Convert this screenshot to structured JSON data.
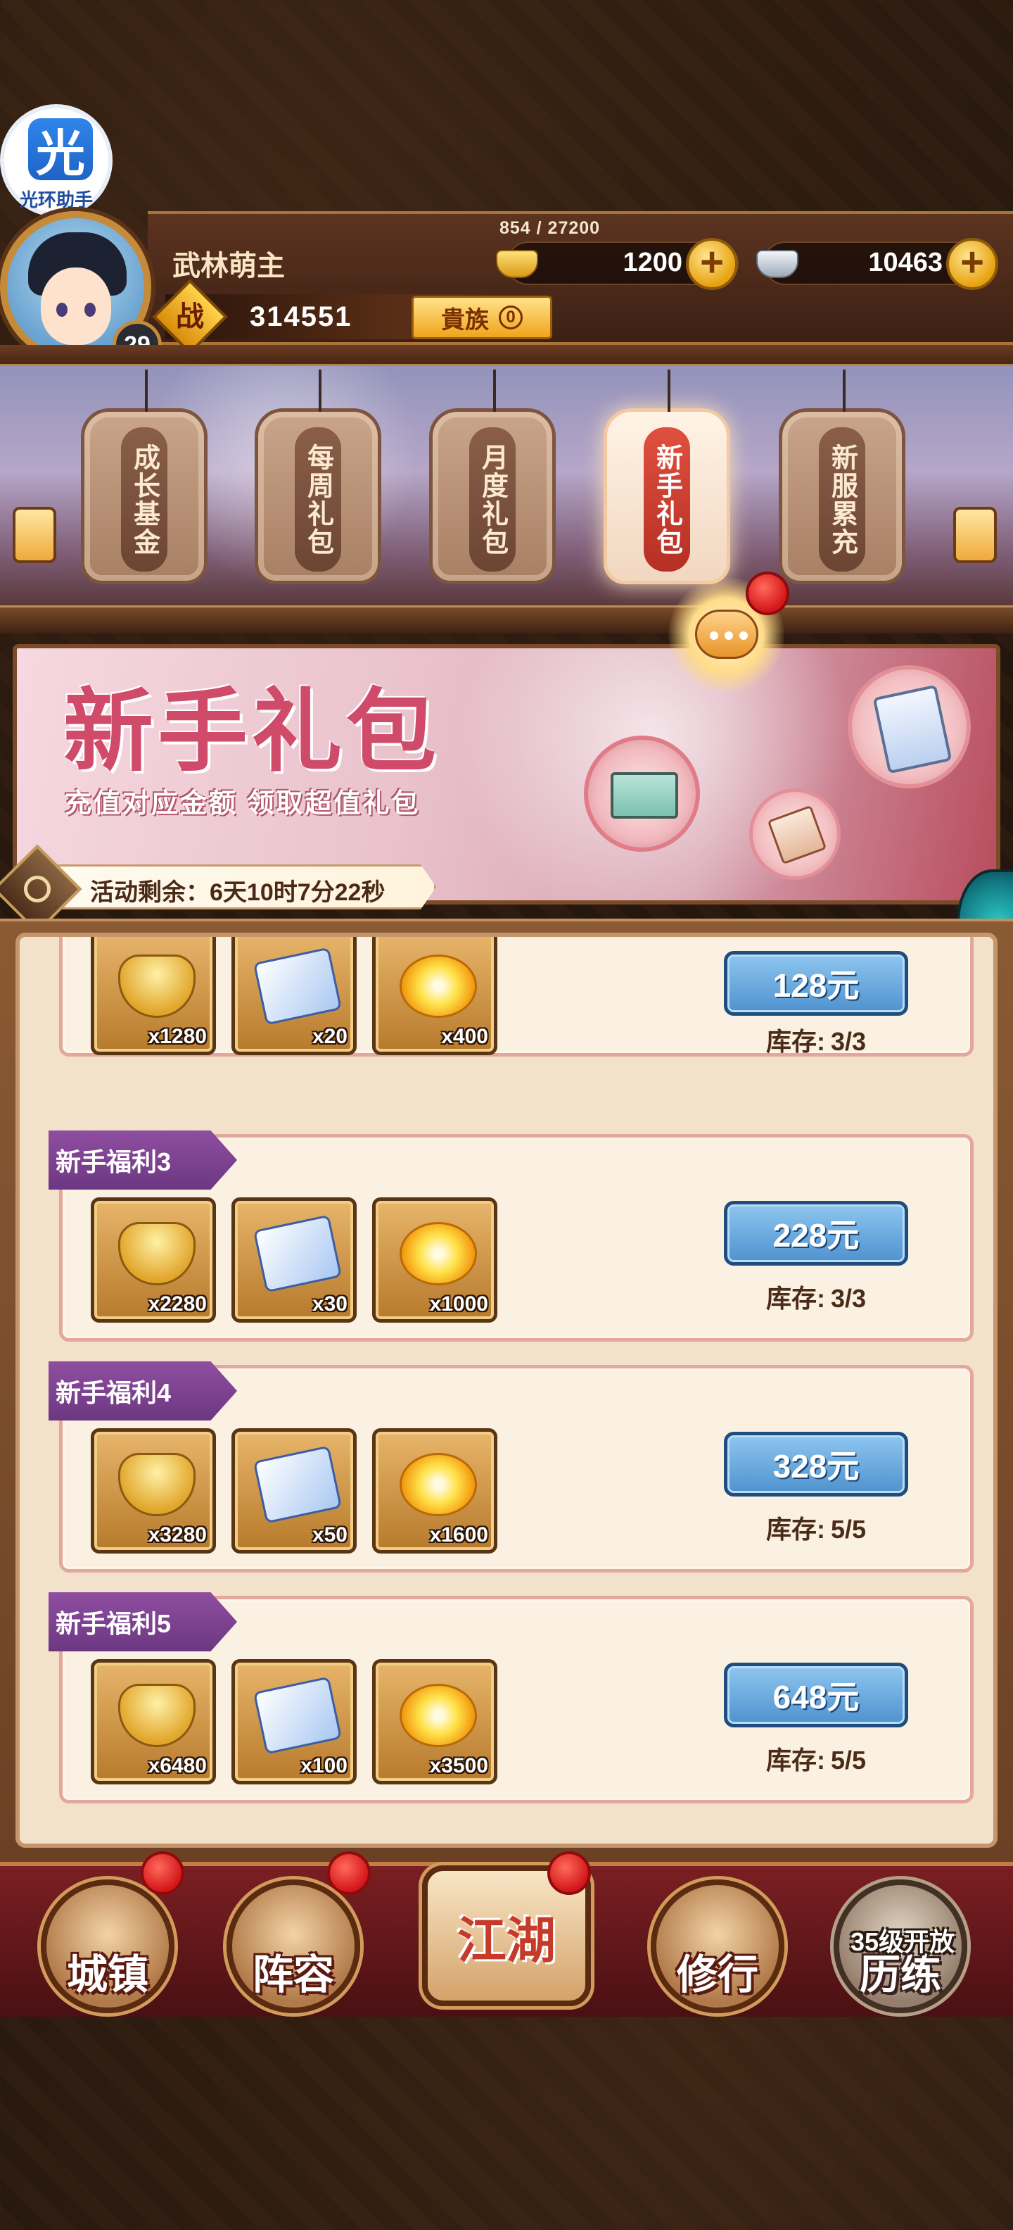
{
  "helper": {
    "glyph": "光",
    "label": "光环助手"
  },
  "player": {
    "name": "武林萌主",
    "level": "29",
    "exp": "854 / 27200",
    "power_icon": "战",
    "power": "314551",
    "noble_label": "貴族",
    "noble_level": "0"
  },
  "currency": {
    "gold": "1200",
    "silver": "10463",
    "plus": "+"
  },
  "tabs": [
    {
      "label": "成长基金",
      "active": false
    },
    {
      "label": "每周礼包",
      "active": false
    },
    {
      "label": "月度礼包",
      "active": false
    },
    {
      "label": "新手礼包",
      "active": true
    },
    {
      "label": "新服累充",
      "active": false
    }
  ],
  "banner": {
    "title": "新手礼包",
    "subtitle": "充值对应金额 领取超值礼包",
    "timer_label": "活动剩余：",
    "timer_value": "6天10时7分22秒"
  },
  "packs": [
    {
      "name": "",
      "items": [
        {
          "icon": "gold-ingot-icon",
          "qty": "x1280"
        },
        {
          "icon": "battle-scroll-icon",
          "qty": "x20"
        },
        {
          "icon": "golden-orb-icon",
          "qty": "x400"
        }
      ],
      "price": "128元",
      "stock_label": "库存:",
      "stock": "3/3"
    },
    {
      "name": "新手福利3",
      "items": [
        {
          "icon": "gold-ingot-icon",
          "qty": "x2280"
        },
        {
          "icon": "battle-scroll-icon",
          "qty": "x30"
        },
        {
          "icon": "golden-orb-icon",
          "qty": "x1000"
        }
      ],
      "price": "228元",
      "stock_label": "库存:",
      "stock": "3/3"
    },
    {
      "name": "新手福利4",
      "items": [
        {
          "icon": "gold-ingot-icon",
          "qty": "x3280"
        },
        {
          "icon": "battle-scroll-icon",
          "qty": "x50"
        },
        {
          "icon": "golden-orb-icon",
          "qty": "x1600"
        }
      ],
      "price": "328元",
      "stock_label": "库存:",
      "stock": "5/5"
    },
    {
      "name": "新手福利5",
      "items": [
        {
          "icon": "gold-ingot-icon",
          "qty": "x6480"
        },
        {
          "icon": "battle-scroll-icon",
          "qty": "x100"
        },
        {
          "icon": "golden-orb-icon",
          "qty": "x3500"
        }
      ],
      "price": "648元",
      "stock_label": "库存:",
      "stock": "5/5"
    }
  ],
  "nav": {
    "town": "城镇",
    "lineup": "阵容",
    "jianghu": "江湖",
    "practice": "修行",
    "trial": "历练",
    "trial_lock": "35级开放"
  },
  "colors": {
    "accent_red": "#d4161a",
    "price_blue": "#4f92cf",
    "ribbon_purple": "#6c3782",
    "gold": "#e7a20f"
  }
}
